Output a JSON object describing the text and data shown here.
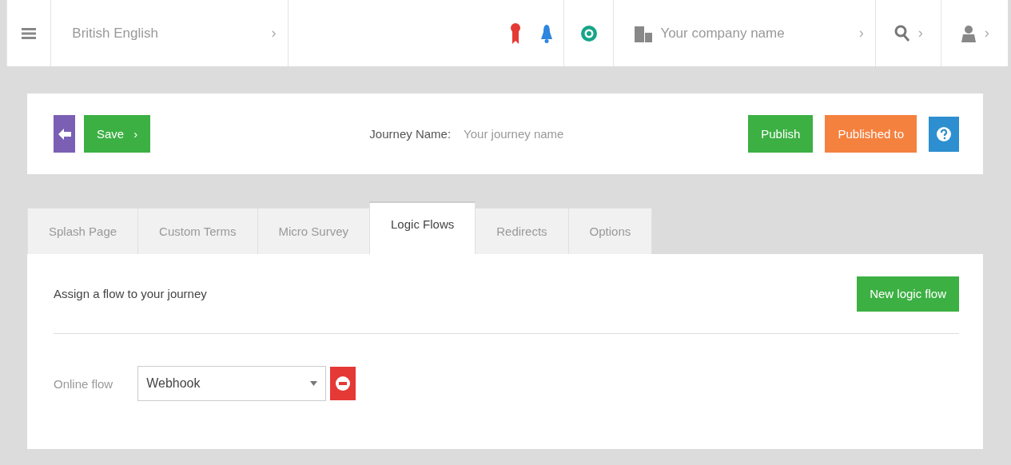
{
  "topbar": {
    "language": "British English",
    "language_chevron": "›",
    "company": "Your company name",
    "company_chevron": "›",
    "search_chevron": "›",
    "user_chevron": "›"
  },
  "toolbar": {
    "save": "Save",
    "save_chevron": "›",
    "journey_label": "Journey Name:",
    "journey_placeholder": "Your journey name",
    "publish": "Publish",
    "published_to": "Published to"
  },
  "tabs": [
    {
      "label": "Splash Page",
      "selected": false
    },
    {
      "label": "Custom Terms",
      "selected": false
    },
    {
      "label": "Micro Survey",
      "selected": false
    },
    {
      "label": "Logic Flows",
      "selected": true
    },
    {
      "label": "Redirects",
      "selected": false
    },
    {
      "label": "Options",
      "selected": false
    }
  ],
  "panel": {
    "heading": "Assign a flow to your journey",
    "new_button": "New logic flow",
    "flow_label": "Online flow",
    "flow_value": "Webhook"
  }
}
